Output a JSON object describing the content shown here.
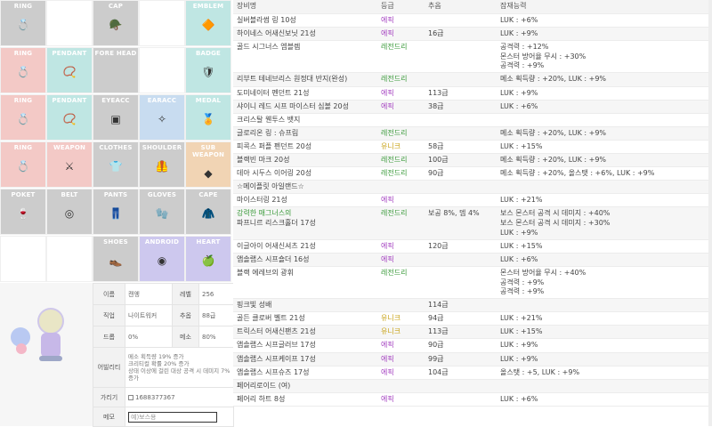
{
  "slots": [
    {
      "label": "RING",
      "icon": "ring-icon",
      "glyph": "💍",
      "color": "gray"
    },
    {
      "label": "",
      "icon": "",
      "glyph": "",
      "color": "none"
    },
    {
      "label": "CAP",
      "icon": "cap-icon",
      "glyph": "🪖",
      "color": "gray"
    },
    {
      "label": "",
      "icon": "",
      "glyph": "",
      "color": "none"
    },
    {
      "label": "EMBLEM",
      "icon": "emblem-icon",
      "glyph": "🔶",
      "color": "teal"
    },
    {
      "label": "RING",
      "icon": "ring-icon",
      "glyph": "💍",
      "color": "red"
    },
    {
      "label": "PENDANT",
      "icon": "pendant-icon",
      "glyph": "📿",
      "color": "teal"
    },
    {
      "label": "FORE HEAD",
      "icon": "forehead-icon",
      "glyph": "",
      "color": "gray"
    },
    {
      "label": "",
      "icon": "",
      "glyph": "",
      "color": "none"
    },
    {
      "label": "BADGE",
      "icon": "badge-icon",
      "glyph": "🛡",
      "color": "teal"
    },
    {
      "label": "RING",
      "icon": "ring-icon",
      "glyph": "💍",
      "color": "red"
    },
    {
      "label": "PENDANT",
      "icon": "pendant-icon",
      "glyph": "📿",
      "color": "teal"
    },
    {
      "label": "EYEACC",
      "icon": "eyeacc-icon",
      "glyph": "▣",
      "color": "gray"
    },
    {
      "label": "EARACC",
      "icon": "earacc-icon",
      "glyph": "✧",
      "color": "blue"
    },
    {
      "label": "MEDAL",
      "icon": "medal-icon",
      "glyph": "🏅",
      "color": "teal"
    },
    {
      "label": "RING",
      "icon": "ring-icon",
      "glyph": "💍",
      "color": "red"
    },
    {
      "label": "WEAPON",
      "icon": "weapon-icon",
      "glyph": "⚔",
      "color": "red"
    },
    {
      "label": "CLOTHES",
      "icon": "clothes-icon",
      "glyph": "👕",
      "color": "gray"
    },
    {
      "label": "SHOULDER",
      "icon": "shoulder-icon",
      "glyph": "🦺",
      "color": "gray"
    },
    {
      "label": "SUB WEAPON",
      "icon": "subweapon-icon",
      "glyph": "◆",
      "color": "peach"
    },
    {
      "label": "POKET",
      "icon": "pocket-icon",
      "glyph": "🍷",
      "color": "gray"
    },
    {
      "label": "BELT",
      "icon": "belt-icon",
      "glyph": "◎",
      "color": "gray"
    },
    {
      "label": "PANTS",
      "icon": "pants-icon",
      "glyph": "👖",
      "color": "gray"
    },
    {
      "label": "GLOVES",
      "icon": "gloves-icon",
      "glyph": "🧤",
      "color": "gray"
    },
    {
      "label": "CAPE",
      "icon": "cape-icon",
      "glyph": "🧥",
      "color": "gray"
    },
    {
      "label": "",
      "icon": "",
      "glyph": "",
      "color": "none"
    },
    {
      "label": "",
      "icon": "",
      "glyph": "",
      "color": "none"
    },
    {
      "label": "SHOES",
      "icon": "shoes-icon",
      "glyph": "👞",
      "color": "gray"
    },
    {
      "label": "ANDROID",
      "icon": "android-icon",
      "glyph": "◉",
      "color": "lav"
    },
    {
      "label": "HEART",
      "icon": "heart-icon",
      "glyph": "🍏",
      "color": "lav"
    }
  ],
  "info": {
    "name_k": "이름",
    "name_v": "캔엥",
    "level_k": "레벨",
    "level_v": "256",
    "job_k": "직업",
    "job_v": "나이트워커",
    "fame_k": "추옵",
    "fame_v": "88급",
    "drop_k": "드롭",
    "drop_v": "0%",
    "meso_k": "메소",
    "meso_v": "80%",
    "ability_k": "어빌리티",
    "ability_lines": [
      "메소 획득량 19% 증가",
      "크리티컬 확률 20% 증가",
      "상태 이상에 걸린 대상 공격 시 데미지 7% 증가"
    ],
    "price_k": "가리기",
    "price_v": "1688377367",
    "memo_k": "메모",
    "memo_placeholder": "예)보스용"
  },
  "table": {
    "headers": [
      "장비명",
      "등급",
      "추옵",
      "잠재능력"
    ],
    "rows": [
      {
        "lines": [
          "실버블라썸 링 10성"
        ],
        "grade": "에픽",
        "gclass": "epic",
        "flame": "",
        "pot": [
          "LUK : +6%"
        ],
        "shade": "w"
      },
      {
        "lines": [
          "하이네스 어새신보닛 21성"
        ],
        "grade": "에픽",
        "gclass": "epic",
        "flame": "16급",
        "pot": [
          "LUK : +9%"
        ],
        "shade": "g"
      },
      {
        "lines": [
          "골드 시그너스 엠블렘"
        ],
        "grade": "레전드리",
        "gclass": "leg",
        "flame": "",
        "pot": [
          "공격력 : +12%",
          "몬스터 방어율 무시 : +30%",
          "공격력 : +9%"
        ],
        "shade": "w"
      },
      {
        "lines": [
          "리부트 테네브리스 원정대 반지(완성)"
        ],
        "grade": "레전드리",
        "gclass": "leg",
        "flame": "",
        "pot": [
          "메소 획득량 : +20%, LUK : +9%"
        ],
        "shade": "g"
      },
      {
        "lines": [
          "도미네이터 펜던트 21성"
        ],
        "grade": "에픽",
        "gclass": "epic",
        "flame": "113급",
        "pot": [
          "LUK : +9%"
        ],
        "shade": "w"
      },
      {
        "lines": [
          "샤이니 레드 시프 마이스터 심볼 20성"
        ],
        "grade": "에픽",
        "gclass": "epic",
        "flame": "38급",
        "pot": [
          "LUK : +6%"
        ],
        "shade": "g"
      },
      {
        "lines": [
          "크리스탈 웬투스 뱃지"
        ],
        "grade": "",
        "gclass": "",
        "flame": "",
        "pot": [],
        "shade": "w"
      },
      {
        "lines": [
          "글로리온 링 : 슈프림"
        ],
        "grade": "레전드리",
        "gclass": "leg",
        "flame": "",
        "pot": [
          "메소 획득량 : +20%, LUK : +9%"
        ],
        "shade": "g"
      },
      {
        "lines": [
          "피콕스 퍼플 펜던트 20성"
        ],
        "grade": "유니크",
        "gclass": "uni",
        "flame": "58급",
        "pot": [
          "LUK : +15%"
        ],
        "shade": "w"
      },
      {
        "lines": [
          "블랙빈 마크 20성"
        ],
        "grade": "레전드리",
        "gclass": "leg",
        "flame": "100급",
        "pot": [
          "메소 획득량 : +20%, LUK : +9%"
        ],
        "shade": "g"
      },
      {
        "lines": [
          "데아 시두스 이어링 20성"
        ],
        "grade": "레전드리",
        "gclass": "leg",
        "flame": "90급",
        "pot": [
          "메소 획득량 : +20%, 올스탯 : +6%, LUK : +9%"
        ],
        "shade": "w"
      },
      {
        "lines": [
          "☆메이플릿 아일랜드☆"
        ],
        "grade": "",
        "gclass": "",
        "flame": "",
        "pot": [],
        "shade": "g"
      },
      {
        "lines": [
          "마이스터링 21성"
        ],
        "grade": "에픽",
        "gclass": "epic",
        "flame": "",
        "pot": [
          "LUK : +21%"
        ],
        "shade": "w"
      },
      {
        "lines": [
          "강력한 매그너스의",
          "파프니르 리스크홀더 17성"
        ],
        "grade": "레전드리",
        "gclass": "leg",
        "flame": "보공 8%, 뎀 4%",
        "pot": [
          "보스 몬스터 공격 시 데미지 : +40%",
          "보스 몬스터 공격 시 데미지 : +30%",
          "LUK : +9%"
        ],
        "shade": "g",
        "green": true
      },
      {
        "lines": [
          "이글아이 어새신셔츠 21성"
        ],
        "grade": "에픽",
        "gclass": "epic",
        "flame": "120급",
        "pot": [
          "LUK : +15%"
        ],
        "shade": "w"
      },
      {
        "lines": [
          "앱솔랩스 시프숄더 16성"
        ],
        "grade": "에픽",
        "gclass": "epic",
        "flame": "",
        "pot": [
          "LUK : +6%"
        ],
        "shade": "g"
      },
      {
        "lines": [
          "블랙 에레브의 광휘"
        ],
        "grade": "레전드리",
        "gclass": "leg",
        "flame": "",
        "pot": [
          "몬스터 방어율 무시 : +40%",
          "공격력 : +9%",
          "공격력 : +9%"
        ],
        "shade": "w"
      },
      {
        "lines": [
          "핑크빛 성배"
        ],
        "grade": "",
        "gclass": "",
        "flame": "114급",
        "pot": [],
        "shade": "g"
      },
      {
        "lines": [
          "골든 클로버 벨트 21성"
        ],
        "grade": "유니크",
        "gclass": "uni",
        "flame": "94급",
        "pot": [
          "LUK : +21%"
        ],
        "shade": "w"
      },
      {
        "lines": [
          "트릭스터 어새신팬츠 21성"
        ],
        "grade": "유니크",
        "gclass": "uni",
        "flame": "113급",
        "pot": [
          "LUK : +15%"
        ],
        "shade": "g"
      },
      {
        "lines": [
          "앱솔랩스 시프글러브 17성"
        ],
        "grade": "에픽",
        "gclass": "epic",
        "flame": "90급",
        "pot": [
          "LUK : +9%"
        ],
        "shade": "w"
      },
      {
        "lines": [
          "앱솔랩스 시프케이프 17성"
        ],
        "grade": "에픽",
        "gclass": "epic",
        "flame": "99급",
        "pot": [
          "LUK : +9%"
        ],
        "shade": "g"
      },
      {
        "lines": [
          "앱솔랩스 시프슈즈 17성"
        ],
        "grade": "에픽",
        "gclass": "epic",
        "flame": "104급",
        "pot": [
          "올스탯 : +5, LUK : +9%"
        ],
        "shade": "w"
      },
      {
        "lines": [
          "페어리로이드 (여)"
        ],
        "grade": "",
        "gclass": "",
        "flame": "",
        "pot": [],
        "shade": "g"
      },
      {
        "lines": [
          "페어리 하트 8성"
        ],
        "grade": "에픽",
        "gclass": "epic",
        "flame": "",
        "pot": [
          "LUK : +6%"
        ],
        "shade": "w"
      }
    ]
  }
}
